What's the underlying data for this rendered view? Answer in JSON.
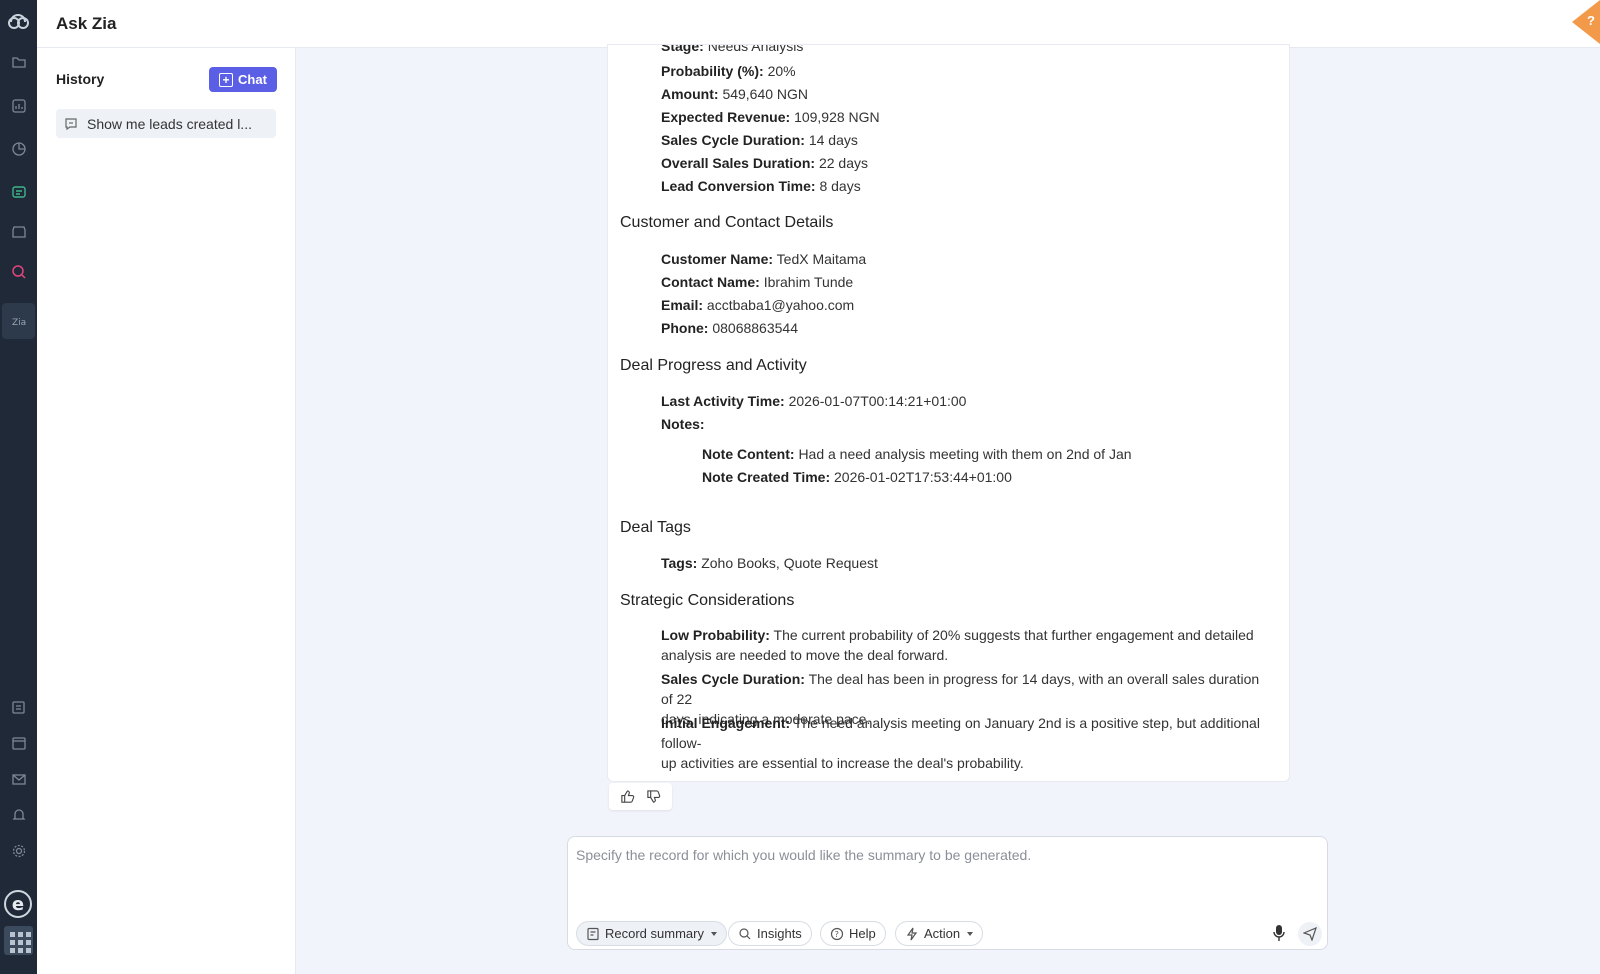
{
  "app": {
    "title": "Ask Zia"
  },
  "history": {
    "title": "History",
    "chat_button": "Chat",
    "items": [
      {
        "label": "Show me leads created l..."
      }
    ]
  },
  "response": {
    "stage": {
      "label": "Stage:",
      "value": "Needs Analysis"
    },
    "deal_fields": [
      {
        "label": "Probability (%):",
        "value": "20%"
      },
      {
        "label": "Amount:",
        "value": "549,640 NGN"
      },
      {
        "label": "Expected Revenue:",
        "value": "109,928 NGN"
      },
      {
        "label": "Sales Cycle Duration:",
        "value": "14 days"
      },
      {
        "label": "Overall Sales Duration:",
        "value": "22 days"
      },
      {
        "label": "Lead Conversion Time:",
        "value": "8 days"
      }
    ],
    "customer_heading": "Customer and Contact Details",
    "customer_fields": [
      {
        "label": "Customer Name:",
        "value": "TedX Maitama"
      },
      {
        "label": "Contact Name:",
        "value": "Ibrahim Tunde"
      },
      {
        "label": "Email:",
        "value": "acctbaba1@yahoo.com"
      },
      {
        "label": "Phone:",
        "value": "08068863544"
      }
    ],
    "progress_heading": "Deal Progress and Activity",
    "last_activity": {
      "label": "Last Activity Time:",
      "value": "2026-01-07T00:14:21+01:00"
    },
    "notes_label": "Notes:",
    "note_content": {
      "label": "Note Content:",
      "value": "Had a need analysis meeting with them on 2nd of Jan"
    },
    "note_created": {
      "label": "Note Created Time:",
      "value": "2026-01-02T17:53:44+01:00"
    },
    "tags_heading": "Deal Tags",
    "tags": {
      "label": "Tags:",
      "value": "Zoho Books, Quote Request"
    },
    "strategic_heading": "Strategic Considerations",
    "considerations": [
      {
        "label": "Low Probability:",
        "line1": "The current probability of 20% suggests that further engagement and detailed",
        "line2": "analysis are needed to move the deal forward."
      },
      {
        "label": "Sales Cycle Duration:",
        "line1": "The deal has been in progress for 14 days, with an overall sales duration of 22",
        "line2": "days, indicating a moderate pace."
      },
      {
        "label": "Initial Engagement:",
        "line1": "The need analysis meeting on January 2nd is a positive step, but additional follow-",
        "line2": "up activities are essential to increase the deal's probability."
      }
    ]
  },
  "composer": {
    "placeholder": "Specify the record for which you would like the summary to be generated.",
    "record_summary": "Record summary",
    "insights": "Insights",
    "help": "Help",
    "action": "Action"
  },
  "colors": {
    "accent": "#5b5fe6",
    "rail": "#1f2937",
    "help_corner": "#f39a4a"
  }
}
